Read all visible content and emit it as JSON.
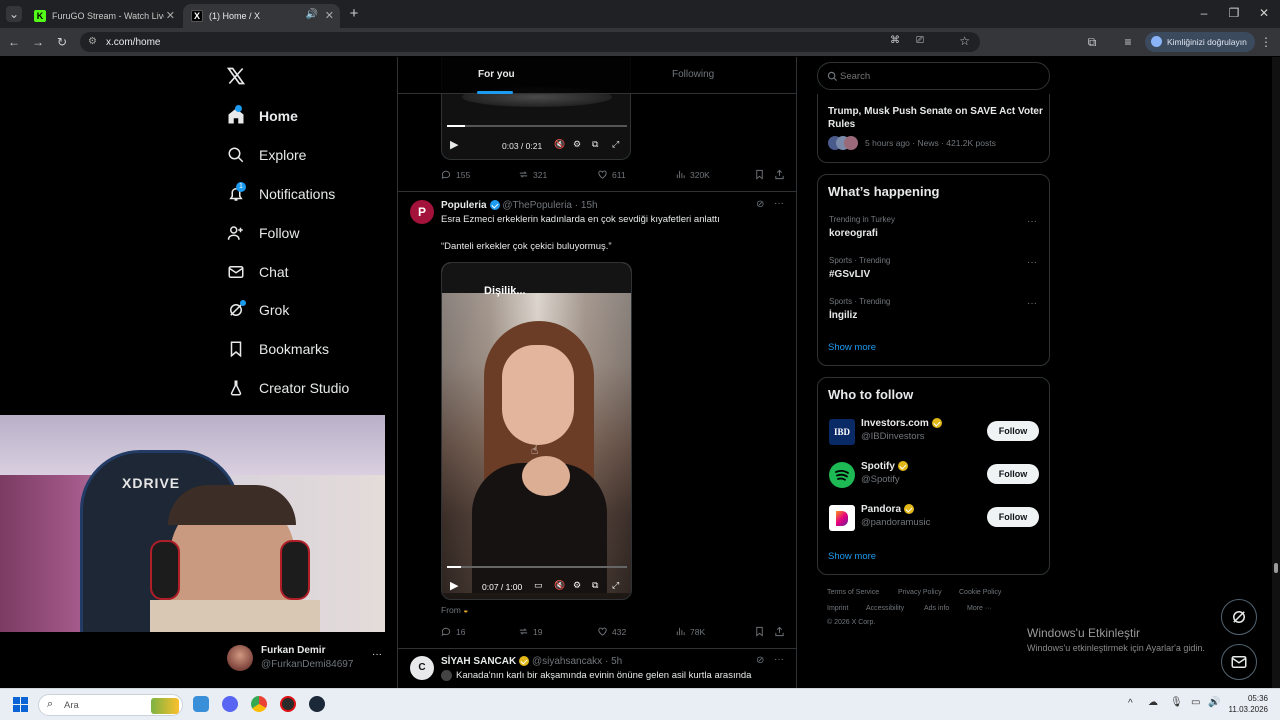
{
  "browser": {
    "tabs": [
      {
        "title": "FuruGO Stream - Watch Live on...",
        "fav": "K"
      },
      {
        "title": "(1) Home / X",
        "fav": "X"
      }
    ],
    "url": "x.com/home",
    "verify_label": "Kimliğinizi doğrulayın"
  },
  "nav": {
    "items": [
      {
        "label": "Home",
        "icon": "home-icon"
      },
      {
        "label": "Explore",
        "icon": "search-icon"
      },
      {
        "label": "Notifications",
        "icon": "bell-icon",
        "badge": "1"
      },
      {
        "label": "Follow",
        "icon": "person-add-icon"
      },
      {
        "label": "Chat",
        "icon": "mail-icon"
      },
      {
        "label": "Grok",
        "icon": "grok-icon"
      },
      {
        "label": "Bookmarks",
        "icon": "bookmark-icon"
      },
      {
        "label": "Creator Studio",
        "icon": "flask-icon"
      }
    ],
    "account": {
      "name": "Furkan Demir",
      "handle": "@FurkanDemi84697"
    }
  },
  "feed": {
    "tabs": [
      "For you",
      "Following"
    ],
    "video1": {
      "time": "0:03 / 0:21",
      "progress": 0.1
    },
    "post1_actions": {
      "replies": "155",
      "reposts": "321",
      "likes": "611",
      "views": "320K"
    },
    "post2": {
      "name": "Populeria",
      "handle": "@ThePopuleria",
      "time": "15h",
      "text1": "Esra Ezmeci erkeklerin kadınlarda en çok sevdiği kıyafetleri anlattı",
      "text2": "“Danteli erkekler çok çekici buluyormuş.”",
      "video_caption": "Dişilik...",
      "video_time": "0:07 / 1:00",
      "progress": 0.08,
      "from_label": "From",
      "actions": {
        "replies": "16",
        "reposts": "19",
        "likes": "432",
        "views": "78K"
      }
    },
    "post3": {
      "name": "SİYAH SANCAK",
      "handle": "@siyahsancakx",
      "time": "5h",
      "text": "Kanada'nın karlı bir akşamında evinin önüne gelen asil kurtla arasında"
    }
  },
  "right": {
    "search_placeholder": "Search",
    "news": {
      "title": "Trump, Musk Push Senate on SAVE Act Voter Rules",
      "meta": "5 hours ago · News · 421.2K posts"
    },
    "happening": {
      "title": "What’s happening",
      "trends": [
        {
          "meta": "Trending in Turkey",
          "name": "koreografi"
        },
        {
          "meta": "Sports · Trending",
          "name": "#GSvLIV"
        },
        {
          "meta": "Sports · Trending",
          "name": "İngiliz"
        }
      ],
      "show_more": "Show more"
    },
    "who_to_follow": {
      "title": "Who to follow",
      "accounts": [
        {
          "name": "Investors.com",
          "handle": "@IBDinvestors",
          "button": "Follow",
          "avatar_text": "IBD"
        },
        {
          "name": "Spotify",
          "handle": "@Spotify",
          "button": "Follow"
        },
        {
          "name": "Pandora",
          "handle": "@pandoramusic",
          "button": "Follow"
        }
      ],
      "show_more": "Show more"
    },
    "footer": {
      "links1": [
        "Terms of Service",
        "Privacy Policy",
        "Cookie Policy"
      ],
      "links2": [
        "Imprint",
        "Accessibility",
        "Ads info",
        "More ···"
      ],
      "copyright": "© 2026 X Corp."
    }
  },
  "watermark": {
    "line1": "Windows'u Etkinleştir",
    "line2": "Windows'u etkinleştirmek için Ayarlar'a gidin."
  },
  "webcam_logo": "XDRIVE",
  "taskbar": {
    "search": "Ara",
    "time": "05:36",
    "date": "11.03.2026"
  },
  "colors": {
    "accent": "#1d9bf0",
    "verified_gold": "#e2b719",
    "bg": "#000000",
    "border": "#2f3336"
  }
}
